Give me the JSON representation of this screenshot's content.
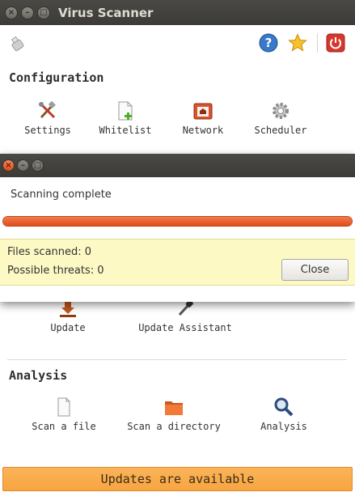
{
  "window": {
    "title": "Virus Scanner"
  },
  "toolbar": {
    "left_icon": "usb-drive-icon",
    "help_icon": "help-icon",
    "favorite_icon": "star-icon",
    "power_icon": "power-icon"
  },
  "configuration": {
    "title": "Configuration",
    "items": [
      {
        "label": "Settings",
        "icon": "tools-icon"
      },
      {
        "label": "Whitelist",
        "icon": "document-add-icon"
      },
      {
        "label": "Network",
        "icon": "network-icon"
      },
      {
        "label": "Scheduler",
        "icon": "gear-icon"
      }
    ]
  },
  "updates": {
    "items": [
      {
        "label": "Update",
        "icon": "download-icon"
      },
      {
        "label": "Update Assistant",
        "icon": "dropper-icon"
      }
    ]
  },
  "analysis": {
    "title": "Analysis",
    "items": [
      {
        "label": "Scan a file",
        "icon": "file-icon"
      },
      {
        "label": "Scan a directory",
        "icon": "folder-icon"
      },
      {
        "label": "Analysis",
        "icon": "magnifier-icon"
      }
    ]
  },
  "status_bar": {
    "text": "Updates are available",
    "color": "#f9ad4c"
  },
  "dialog": {
    "status": "Scanning complete",
    "progress": 1.0,
    "files_scanned": "Files scanned: 0",
    "possible_threats": "Possible threats: 0",
    "close_label": "Close",
    "accent": "#e3531f"
  }
}
